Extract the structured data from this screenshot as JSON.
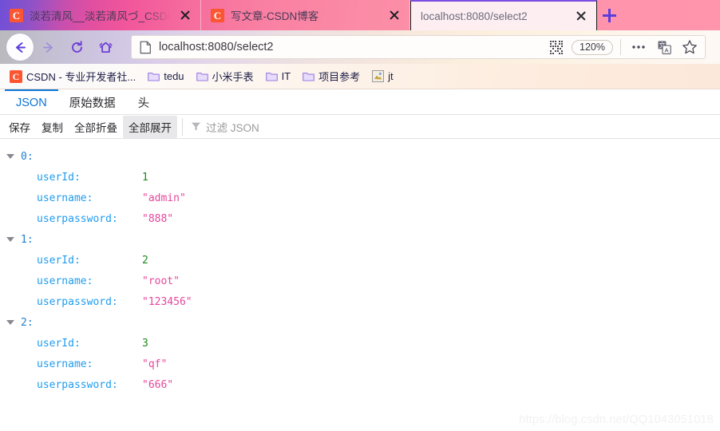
{
  "browser": {
    "tabs": [
      {
        "title": "淡若清风__淡若清风づ_CSDN博",
        "favicon": "csdn-icon",
        "active": false,
        "close_label": "×"
      },
      {
        "title": "写文章-CSDN博客",
        "favicon": "csdn-icon",
        "active": false,
        "close_label": "×"
      },
      {
        "title": "localhost:8080/select2",
        "favicon": "none",
        "active": true,
        "close_label": "×"
      }
    ],
    "new_tab_label": "+",
    "nav": {
      "back_icon": "back-arrow-icon",
      "forward_icon": "forward-arrow-icon",
      "reload_icon": "reload-icon",
      "home_icon": "home-icon"
    },
    "urlbar": {
      "page_icon": "page-document-icon",
      "url": "localhost:8080/select2",
      "qr_icon": "qr-code-icon",
      "zoom_level": "120%",
      "menu_icon": "ellipsis-icon",
      "translate_icon": "translate-icon",
      "bookmark_icon": "star-icon"
    },
    "bookmarks": [
      {
        "label": "CSDN - 专业开发者社...",
        "icon": "csdn-icon"
      },
      {
        "label": "tedu",
        "icon": "folder-icon"
      },
      {
        "label": "小米手表",
        "icon": "folder-icon"
      },
      {
        "label": "IT",
        "icon": "folder-icon"
      },
      {
        "label": "项目参考",
        "icon": "folder-icon"
      },
      {
        "label": "jt",
        "icon": "image-icon"
      }
    ]
  },
  "json_viewer": {
    "tabs": [
      {
        "label": "JSON",
        "active": true
      },
      {
        "label": "原始数据",
        "active": false
      },
      {
        "label": "头",
        "active": false
      }
    ],
    "toolbar": {
      "save": "保存",
      "copy": "复制",
      "collapse_all": "全部折叠",
      "expand_all": "全部展开",
      "filter_icon": "filter-funnel-icon",
      "filter_placeholder": "过滤 JSON"
    },
    "colors": {
      "key": "#1f9cf0",
      "index": "#1f7fd0",
      "number": "#1e8a1e",
      "string": "#e5489c",
      "tab_active": "#0a74d8"
    },
    "tree": [
      {
        "index": "0:",
        "props": [
          {
            "key": "userId:",
            "value": "1",
            "type": "number"
          },
          {
            "key": "username:",
            "value": "\"admin\"",
            "type": "string"
          },
          {
            "key": "userpassword:",
            "value": "\"888\"",
            "type": "string"
          }
        ]
      },
      {
        "index": "1:",
        "props": [
          {
            "key": "userId:",
            "value": "2",
            "type": "number"
          },
          {
            "key": "username:",
            "value": "\"root\"",
            "type": "string"
          },
          {
            "key": "userpassword:",
            "value": "\"123456\"",
            "type": "string"
          }
        ]
      },
      {
        "index": "2:",
        "props": [
          {
            "key": "userId:",
            "value": "3",
            "type": "number"
          },
          {
            "key": "username:",
            "value": "\"qf\"",
            "type": "string"
          },
          {
            "key": "userpassword:",
            "value": "\"666\"",
            "type": "string"
          }
        ]
      }
    ]
  },
  "watermark": "https://blog.csdn.net/QQ1043051018"
}
